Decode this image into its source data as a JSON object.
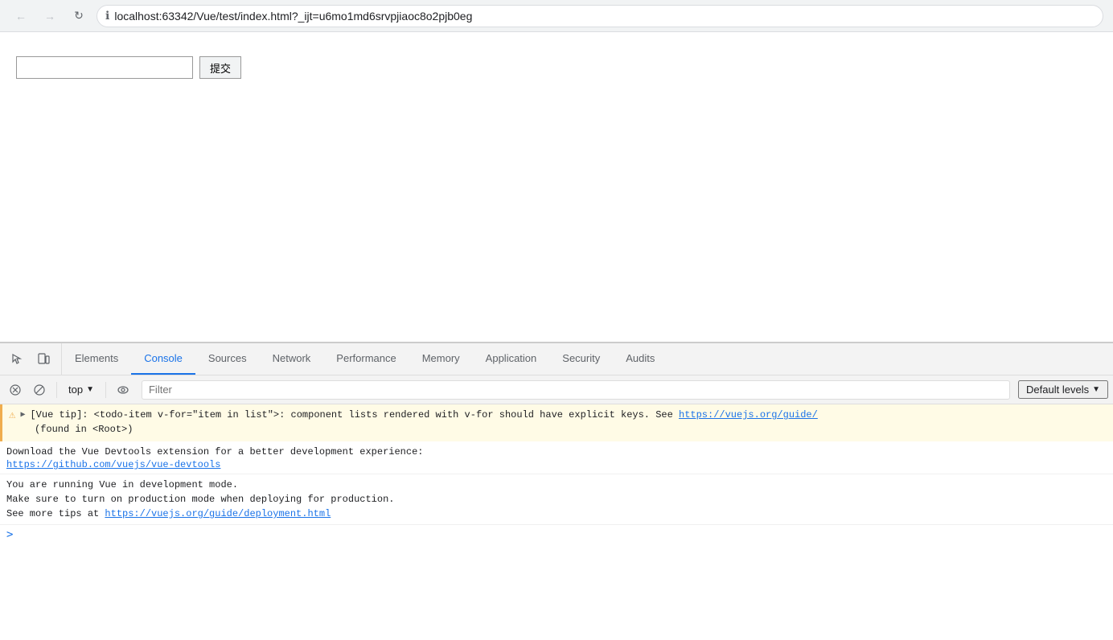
{
  "browser": {
    "back_disabled": true,
    "forward_disabled": true,
    "reload_label": "↻",
    "info_icon": "ℹ",
    "url": "localhost:63342/Vue/test/index.html?_ijt=u6mo1md6srvpjiaoc8o2pjb0eg"
  },
  "page": {
    "input_placeholder": "",
    "submit_button": "提交"
  },
  "devtools": {
    "tabs": [
      {
        "label": "Elements",
        "active": false
      },
      {
        "label": "Console",
        "active": true
      },
      {
        "label": "Sources",
        "active": false
      },
      {
        "label": "Network",
        "active": false
      },
      {
        "label": "Performance",
        "active": false
      },
      {
        "label": "Memory",
        "active": false
      },
      {
        "label": "Application",
        "active": false
      },
      {
        "label": "Security",
        "active": false
      },
      {
        "label": "Audits",
        "active": false
      }
    ],
    "console": {
      "context": "top",
      "filter_placeholder": "Filter",
      "levels": "Default levels",
      "messages": [
        {
          "type": "warning",
          "text": "[Vue tip]: <todo-item v-for=\"item in list\">: component lists rendered with v-for should have explicit keys. See https://vuejs.org/guide/",
          "link": "https://vuejs.org/guide/",
          "subtext": "(found in <Root>)"
        },
        {
          "type": "info",
          "line1": "Download the Vue Devtools extension for a better development experience:",
          "link": "https://github.com/vuejs/vue-devtools"
        },
        {
          "type": "plain",
          "lines": [
            "You are running Vue in development mode.",
            "Make sure to turn on production mode when deploying for production.",
            "See more tips at https://vuejs.org/guide/deployment.html"
          ],
          "link": "https://vuejs.org/guide/deployment.html"
        }
      ]
    }
  }
}
